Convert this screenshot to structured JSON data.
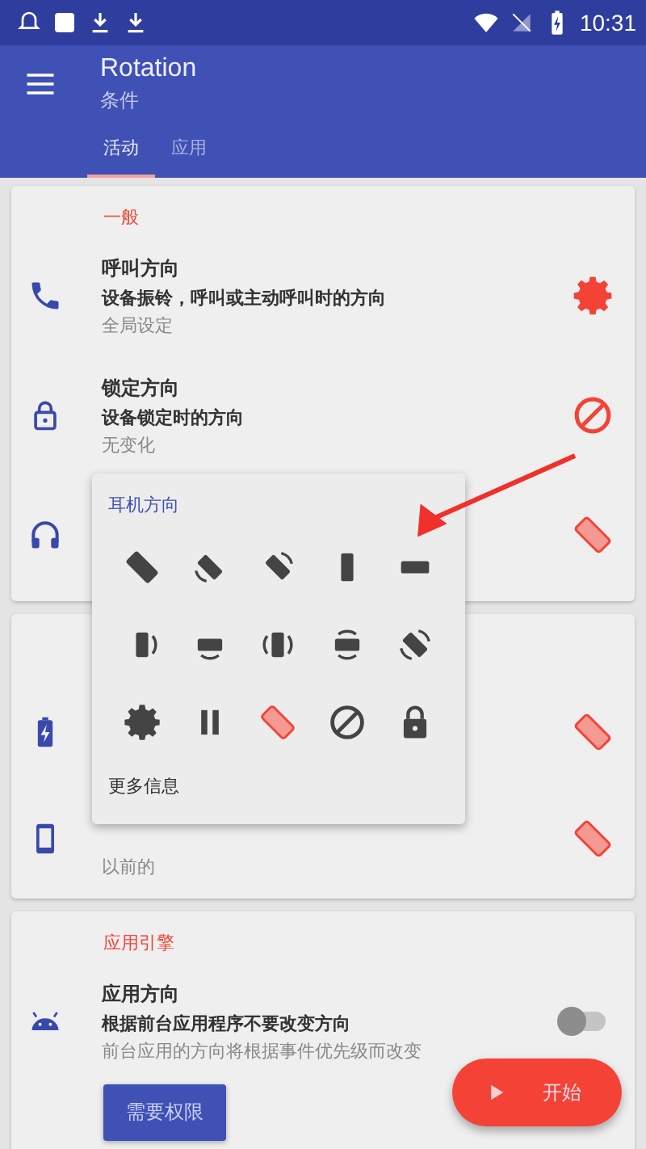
{
  "status_bar": {
    "time": "10:31"
  },
  "app_bar": {
    "title": "Rotation",
    "subtitle": "条件"
  },
  "tabs": [
    {
      "label": "活动",
      "selected": true
    },
    {
      "label": "应用",
      "selected": false
    }
  ],
  "sections": [
    {
      "header": "一般",
      "rows": [
        {
          "title": "呼叫方向",
          "subtitle": "设备振铃，呼叫或主动呼叫时的方向",
          "value": "全局设定"
        },
        {
          "title": "锁定方向",
          "subtitle": "设备锁定时的方向",
          "value": "无变化"
        }
      ]
    },
    {
      "rows": [
        {
          "value": "以前的"
        }
      ]
    },
    {
      "header": "应用引擎",
      "rows": [
        {
          "title": "应用方向",
          "subtitle": "根据前台应用程序不要改变方向",
          "value": "前台应用的方向将根据事件优先级而改变",
          "toggle": {
            "on": false
          }
        }
      ],
      "button": "需要权限"
    }
  ],
  "popup": {
    "title": "耳机方向",
    "options": [
      {
        "kind": "tilt",
        "selected": false
      },
      {
        "kind": "tilt-rotate-left",
        "selected": false
      },
      {
        "kind": "tilt-rotate-right",
        "selected": false
      },
      {
        "kind": "portrait",
        "selected": false
      },
      {
        "kind": "landscape",
        "selected": false
      },
      {
        "kind": "portrait-rotate-right",
        "selected": false
      },
      {
        "kind": "landscape-rotate-bottom",
        "selected": false
      },
      {
        "kind": "portrait-rotate-both",
        "selected": false
      },
      {
        "kind": "landscape-rotate-both",
        "selected": false
      },
      {
        "kind": "tilt-rotate-both",
        "selected": false
      },
      {
        "kind": "gear",
        "selected": false
      },
      {
        "kind": "pause",
        "selected": false
      },
      {
        "kind": "tilt",
        "selected": true
      },
      {
        "kind": "blocked",
        "selected": false
      },
      {
        "kind": "lock",
        "selected": false
      }
    ],
    "more": "更多信息"
  },
  "fab": {
    "label": "开始"
  }
}
